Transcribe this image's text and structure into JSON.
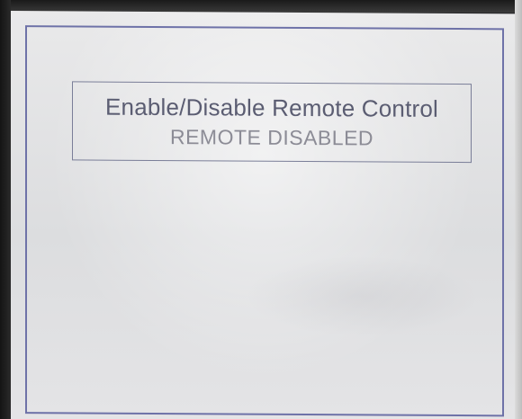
{
  "screen": {
    "title": "Enable/Disable Remote Control",
    "status": "REMOTE DISABLED"
  },
  "colors": {
    "frame": "#6e72a8",
    "title_text": "#5b5d72",
    "status_text": "#8c8c96",
    "lcd_background": "#e4e4e6"
  }
}
